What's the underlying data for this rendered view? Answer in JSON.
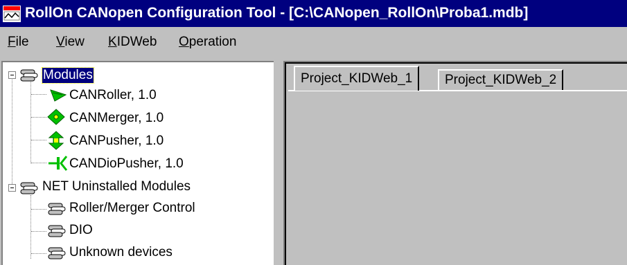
{
  "window": {
    "title": "RollOn CANopen Configuration Tool - [C:\\CANopen_RollOn\\Proba1.mdb]"
  },
  "menu": {
    "items": [
      {
        "label": "File",
        "mnemonic": "F",
        "rest": "ile"
      },
      {
        "label": "View",
        "mnemonic": "V",
        "rest": "iew"
      },
      {
        "label": "KIDWeb",
        "mnemonic": "K",
        "rest": "IDWeb"
      },
      {
        "label": "Operation",
        "mnemonic": "O",
        "rest": "peration"
      }
    ]
  },
  "tree": {
    "modules": {
      "label": "Modules",
      "children": [
        {
          "label": "CANRoller, 1.0",
          "icon": "roller-icon"
        },
        {
          "label": "CANMerger, 1.0",
          "icon": "merger-icon"
        },
        {
          "label": "CANPusher, 1.0",
          "icon": "pusher-icon"
        },
        {
          "label": "CANDioPusher, 1.0",
          "icon": "diopusher-icon"
        }
      ]
    },
    "net": {
      "label": "NET Uninstalled Modules",
      "children": [
        {
          "label": "Roller/Merger Control",
          "icon": "device-group-icon"
        },
        {
          "label": "DIO",
          "icon": "device-group-icon"
        },
        {
          "label": "Unknown devices",
          "icon": "device-group-icon"
        }
      ]
    }
  },
  "tabs": [
    {
      "label": "Project_KIDWeb_1",
      "active": true
    },
    {
      "label": "Project_KIDWeb_2",
      "active": false
    }
  ],
  "colors": {
    "titlebar": "#00007f",
    "selection": "#00007f",
    "icon_green": "#00c000",
    "face": "#c0c0c0"
  }
}
